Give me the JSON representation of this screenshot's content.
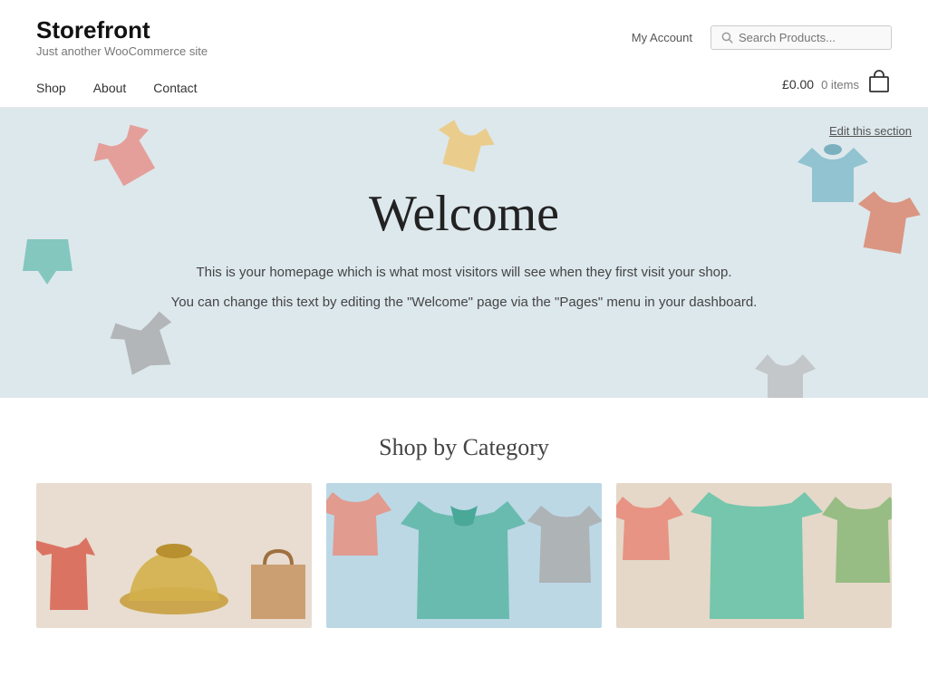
{
  "header": {
    "logo": {
      "title": "Storefront",
      "subtitle": "Just another WooCommerce site"
    },
    "my_account_label": "My Account",
    "search_placeholder": "Search Products...",
    "cart": {
      "total": "£0.00",
      "items_label": "0 items"
    }
  },
  "nav": {
    "links": [
      {
        "label": "Shop",
        "id": "shop"
      },
      {
        "label": "About",
        "id": "about"
      },
      {
        "label": "Contact",
        "id": "contact"
      }
    ]
  },
  "hero": {
    "edit_label": "Edit this section",
    "title": "Welcome",
    "text1": "This is your homepage which is what most visitors will see when they first visit your shop.",
    "text2": "You can change this text by editing the \"Welcome\" page via the \"Pages\" menu in your dashboard."
  },
  "shop_section": {
    "title": "Shop by Category",
    "categories": [
      {
        "id": "cat-1",
        "bg": "#e8e0d8"
      },
      {
        "id": "cat-2",
        "bg": "#c8dde8"
      },
      {
        "id": "cat-3",
        "bg": "#e8dcd0"
      }
    ]
  }
}
